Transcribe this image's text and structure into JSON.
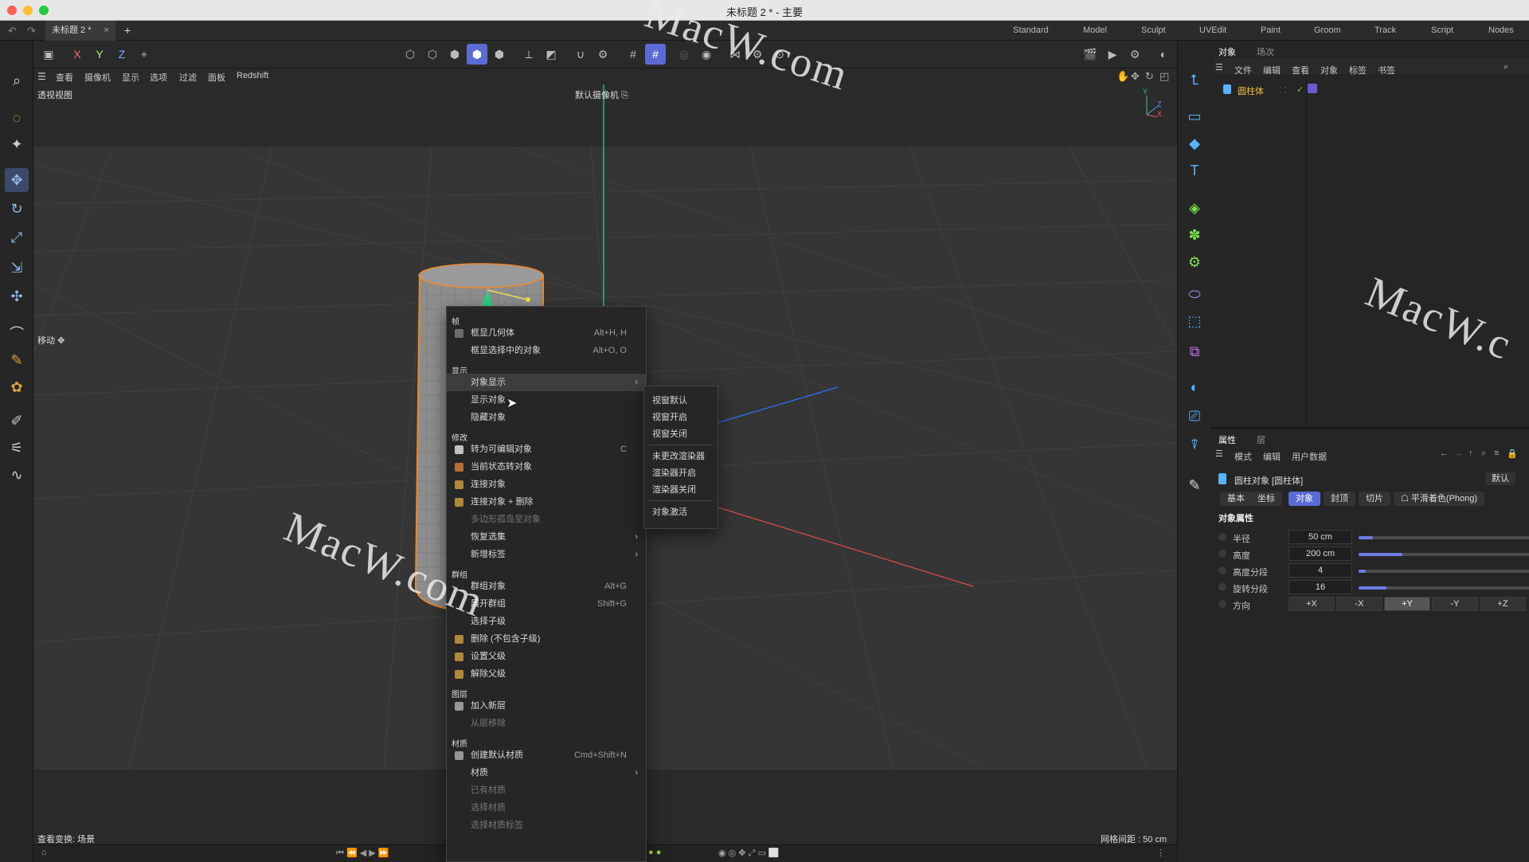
{
  "window": {
    "title": "未标题 2 * - 主要"
  },
  "tabs": [
    {
      "label": "未标题 2 *"
    },
    {
      "label": "+"
    }
  ],
  "layouts": [
    "Standard",
    "Model",
    "Sculpt",
    "UVEdit",
    "Paint",
    "Groom",
    "Track",
    "Script",
    "Nodes"
  ],
  "viewport": {
    "menu": [
      "查看",
      "摄像机",
      "显示",
      "选项",
      "过滤",
      "面板",
      "Redshift"
    ],
    "label": "透视视图",
    "camera": "默认摄像机",
    "status_left": "查看变换: 场景",
    "status_right": "网格间距 : 50 cm",
    "move_label": "移动"
  },
  "context_menu": {
    "sections": [
      {
        "title": "帧",
        "items": [
          {
            "label": "框显几何体",
            "shortcut": "Alt+H, H"
          },
          {
            "label": "框显选择中的对象",
            "shortcut": "Alt+O, O"
          }
        ]
      },
      {
        "title": "显示",
        "items": [
          {
            "label": "对象显示",
            "submenu": true,
            "highlighted": true
          },
          {
            "label": "显示对象"
          },
          {
            "label": "隐藏对象"
          }
        ]
      },
      {
        "title": "修改",
        "items": [
          {
            "label": "转为可编辑对象",
            "shortcut": "C"
          },
          {
            "label": "当前状态转对象"
          },
          {
            "label": "连接对象"
          },
          {
            "label": "连接对象 + 删除"
          },
          {
            "label": "多边形孤岛至对象",
            "disabled": true
          },
          {
            "label": "恢复选集",
            "submenu": true
          },
          {
            "label": "新增标签",
            "submenu": true
          }
        ]
      },
      {
        "title": "群组",
        "items": [
          {
            "label": "群组对象",
            "shortcut": "Alt+G"
          },
          {
            "label": "展开群组",
            "shortcut": "Shift+G"
          },
          {
            "label": "选择子级"
          },
          {
            "label": "删除 (不包含子级)"
          },
          {
            "label": "设置父级"
          },
          {
            "label": "解除父级"
          }
        ]
      },
      {
        "title": "图层",
        "items": [
          {
            "label": "加入新层"
          },
          {
            "label": "从层移除",
            "disabled": true
          }
        ]
      },
      {
        "title": "材质",
        "items": [
          {
            "label": "创建默认材质",
            "shortcut": "Cmd+Shift+N"
          },
          {
            "label": "材质",
            "submenu": true
          },
          {
            "label": "已有材质",
            "disabled": true
          },
          {
            "label": "选择材质",
            "disabled": true
          },
          {
            "label": "选择材质标签",
            "disabled": true
          }
        ]
      }
    ],
    "submenu": [
      "视窗默认",
      "视窗开启",
      "视窗关闭",
      "未更改渲染器",
      "渲染器开启",
      "渲染器关闭",
      "对象激活"
    ]
  },
  "object_panel": {
    "tabs": [
      "对象",
      "场次"
    ],
    "menu": [
      "文件",
      "编辑",
      "查看",
      "对象",
      "标签",
      "书签"
    ],
    "object_name": "圆柱体"
  },
  "attribute_panel": {
    "tabs": [
      "属性",
      "层"
    ],
    "menu": [
      "模式",
      "编辑",
      "用户数据"
    ],
    "object_title": "圆柱对象 [圆柱体]",
    "preset": "默认",
    "attr_tabs": [
      "基本",
      "坐标",
      "对象",
      "封顶",
      "切片",
      "平滑着色(Phong)"
    ],
    "active_tab": "对象",
    "section_title": "对象属性",
    "fields": [
      {
        "label": "半径",
        "value": "50 cm",
        "level": 0.08
      },
      {
        "label": "高度",
        "value": "200 cm",
        "level": 0.25
      },
      {
        "label": "高度分段",
        "value": "4",
        "level": 0.04
      },
      {
        "label": "旋转分段",
        "value": "16",
        "level": 0.16
      }
    ],
    "direction_label": "方向",
    "directions": [
      "+X",
      "-X",
      "+Y",
      "-Y",
      "+Z"
    ],
    "active_direction": "+Y"
  },
  "watermarks": [
    "MacW.com",
    "MacW.com",
    "MacW.c"
  ],
  "axis_labels": [
    "Y",
    "Z",
    "X"
  ]
}
